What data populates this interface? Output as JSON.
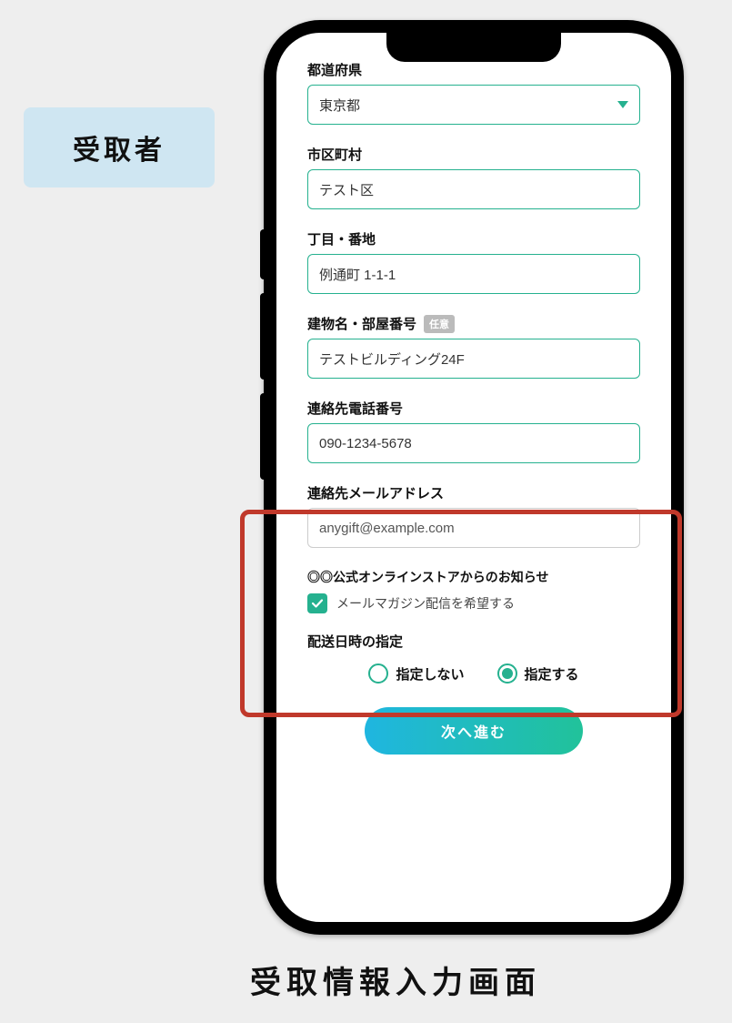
{
  "sideLabel": "受取者",
  "caption": "受取情報入力画面",
  "form": {
    "prefecture": {
      "label": "都道府県",
      "value": "東京都"
    },
    "city": {
      "label": "市区町村",
      "value": "テスト区"
    },
    "street": {
      "label": "丁目・番地",
      "value": "例通町 1-1-1"
    },
    "building": {
      "label": "建物名・部屋番号",
      "optional": "任意",
      "value": "テストビルディング24F"
    },
    "phone": {
      "label": "連絡先電話番号",
      "value": "090-1234-5678"
    },
    "email": {
      "label": "連絡先メールアドレス",
      "value": "anygift@example.com"
    }
  },
  "newsletter": {
    "title": "◎◎公式オンラインストアからのお知らせ",
    "checkboxLabel": "メールマガジン配信を希望する",
    "checked": true
  },
  "delivery": {
    "title": "配送日時の指定",
    "options": [
      "指定しない",
      "指定する"
    ],
    "selectedIndex": 1
  },
  "primaryButton": "次へ進む"
}
